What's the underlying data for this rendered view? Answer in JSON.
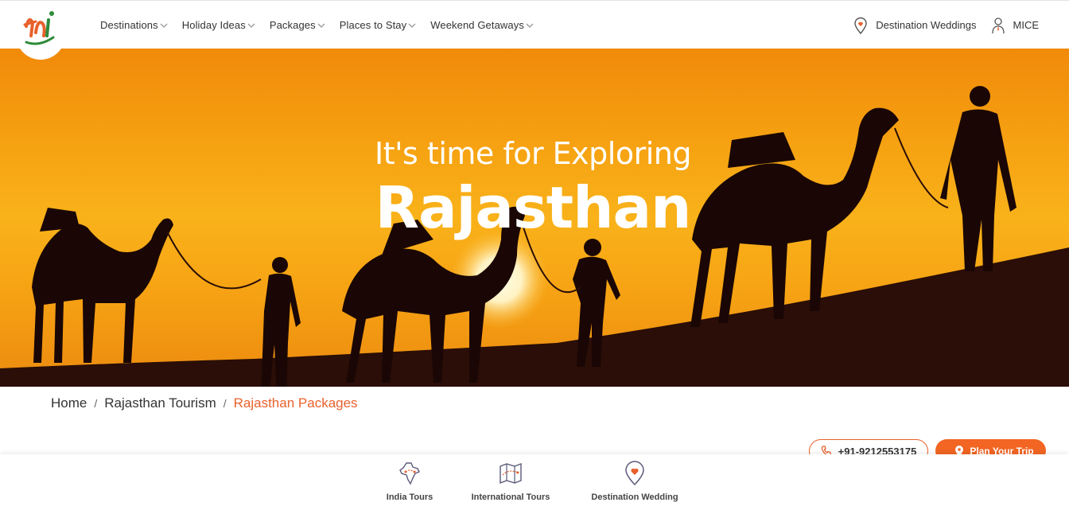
{
  "header": {
    "logo_alt": "ti",
    "nav": [
      {
        "label": "Destinations"
      },
      {
        "label": "Holiday Ideas"
      },
      {
        "label": "Packages"
      },
      {
        "label": "Places to Stay"
      },
      {
        "label": "Weekend Getaways"
      }
    ],
    "right": {
      "weddings_label": "Destination Weddings",
      "mice_label": "MICE"
    }
  },
  "hero": {
    "subtitle": "It's time for Exploring",
    "title": "Rajasthan"
  },
  "breadcrumb": {
    "items": [
      "Home",
      "Rajasthan Tourism",
      "Rajasthan Packages"
    ],
    "separator": "/"
  },
  "actions": {
    "phone": "+91-9212553175",
    "plan": "Plan Your Trip"
  },
  "bottom_tabs": [
    {
      "label": "India Tours",
      "icon": "india-map-icon"
    },
    {
      "label": "International Tours",
      "icon": "folded-map-icon"
    },
    {
      "label": "Destination Wedding",
      "icon": "heart-pin-icon"
    }
  ],
  "colors": {
    "accent": "#f26522",
    "breadcrumb_active": "#e8612c",
    "hero_sky": "#f6a312"
  }
}
